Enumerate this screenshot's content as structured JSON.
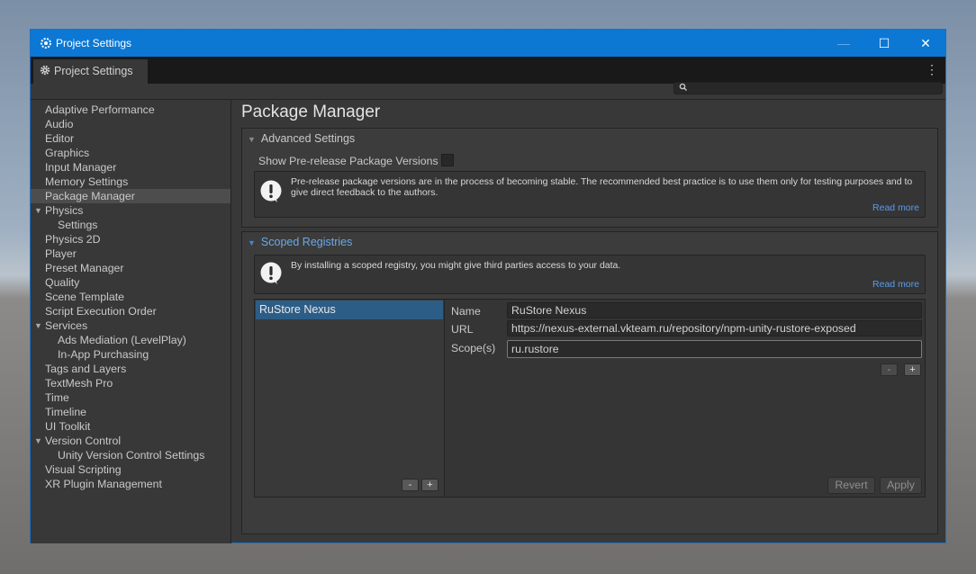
{
  "window": {
    "title": "Project Settings",
    "minimize": "—",
    "maximize": "☐",
    "close": "✕"
  },
  "tab": {
    "label": "Project Settings",
    "more": "⋮"
  },
  "search": {
    "placeholder": "",
    "value": ""
  },
  "sidebar": {
    "items": [
      {
        "label": "Adaptive Performance",
        "indent": 0
      },
      {
        "label": "Audio",
        "indent": 0
      },
      {
        "label": "Editor",
        "indent": 0
      },
      {
        "label": "Graphics",
        "indent": 0
      },
      {
        "label": "Input Manager",
        "indent": 0
      },
      {
        "label": "Memory Settings",
        "indent": 0
      },
      {
        "label": "Package Manager",
        "indent": 0,
        "selected": true
      },
      {
        "label": "Physics",
        "indent": 0,
        "foldout": true
      },
      {
        "label": "Settings",
        "indent": 1
      },
      {
        "label": "Physics 2D",
        "indent": 0
      },
      {
        "label": "Player",
        "indent": 0
      },
      {
        "label": "Preset Manager",
        "indent": 0
      },
      {
        "label": "Quality",
        "indent": 0
      },
      {
        "label": "Scene Template",
        "indent": 0
      },
      {
        "label": "Script Execution Order",
        "indent": 0
      },
      {
        "label": "Services",
        "indent": 0,
        "foldout": true
      },
      {
        "label": "Ads Mediation (LevelPlay)",
        "indent": 1
      },
      {
        "label": "In-App Purchasing",
        "indent": 1
      },
      {
        "label": "Tags and Layers",
        "indent": 0
      },
      {
        "label": "TextMesh Pro",
        "indent": 0
      },
      {
        "label": "Time",
        "indent": 0
      },
      {
        "label": "Timeline",
        "indent": 0
      },
      {
        "label": "UI Toolkit",
        "indent": 0
      },
      {
        "label": "Version Control",
        "indent": 0,
        "foldout": true
      },
      {
        "label": "Unity Version Control Settings",
        "indent": 1
      },
      {
        "label": "Visual Scripting",
        "indent": 0
      },
      {
        "label": "XR Plugin Management",
        "indent": 0
      }
    ]
  },
  "main": {
    "title": "Package Manager",
    "advanced": {
      "header": "Advanced Settings",
      "prerelease_label": "Show Pre-release Package Versions",
      "prerelease_checked": false,
      "help_text": "Pre-release package versions are in the process of becoming stable. The recommended best practice is to use them only for testing purposes and to give direct feedback to the authors.",
      "read_more": "Read more"
    },
    "scoped": {
      "header": "Scoped Registries",
      "help_text": "By installing a scoped registry, you might give third parties access to your data.",
      "read_more": "Read more",
      "registries": [
        "RuStore Nexus"
      ],
      "list_remove": "-",
      "list_add": "+",
      "name_label": "Name",
      "name_value": "RuStore Nexus",
      "url_label": "URL",
      "url_value": "https://nexus-external.vkteam.ru/repository/npm-unity-rustore-exposed",
      "scope_label": "Scope(s)",
      "scope_value": "ru.rustore",
      "scope_remove": "-",
      "scope_add": "+",
      "revert": "Revert",
      "apply": "Apply"
    }
  },
  "colors": {
    "titlebar": "#0c78d4",
    "panel": "#383838",
    "selection": "#2c5d87",
    "link": "#589cf0"
  }
}
